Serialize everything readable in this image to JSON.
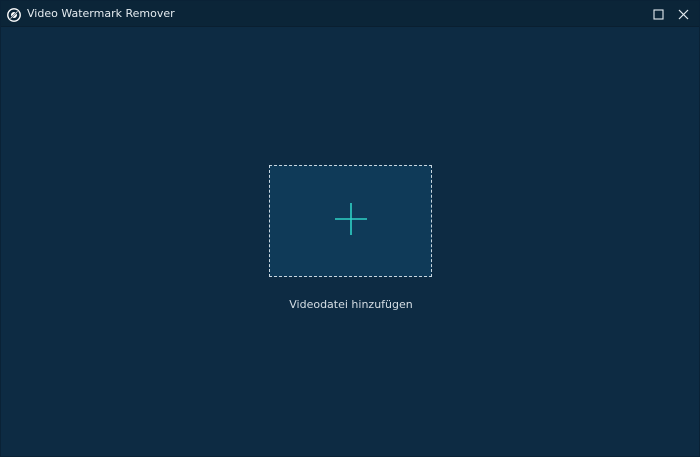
{
  "window": {
    "title": "Video Watermark Remover",
    "app_icon": "watermark-remover-logo-icon",
    "controls": {
      "maximize_icon": "maximize-icon",
      "close_icon": "close-icon"
    }
  },
  "main": {
    "add_icon": "plus-icon",
    "add_label": "Videodatei hinzufügen"
  },
  "colors": {
    "background": "#0d2b43",
    "titlebar": "#0b2538",
    "drop_zone": "#0f3a58",
    "accent": "#2fd1c5",
    "text": "#d5dee5"
  }
}
